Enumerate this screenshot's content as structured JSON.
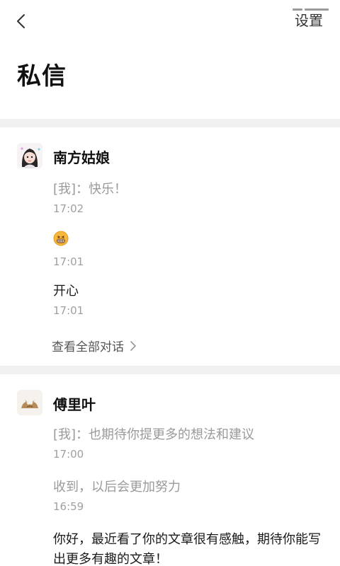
{
  "nav": {
    "settings_label": "设置"
  },
  "title": "私信",
  "conversations": [
    {
      "name": "南方姑娘",
      "messages": [
        {
          "text": "[我]：快乐！",
          "time": "17:02",
          "muted": true
        },
        {
          "emoji": "😬",
          "time": "17:01"
        },
        {
          "text": "开心",
          "time": "17:01"
        }
      ],
      "view_all": "查看全部对话"
    },
    {
      "name": "傅里叶",
      "messages": [
        {
          "text": "[我]：也期待你提更多的想法和建议",
          "time": "17:00",
          "muted": true
        },
        {
          "text": "收到，以后会更加努力",
          "time": "16:59",
          "muted": true
        },
        {
          "text": "你好，最近看了你的文章很有感触，期待你能写出更多有趣的文章！"
        }
      ]
    }
  ]
}
